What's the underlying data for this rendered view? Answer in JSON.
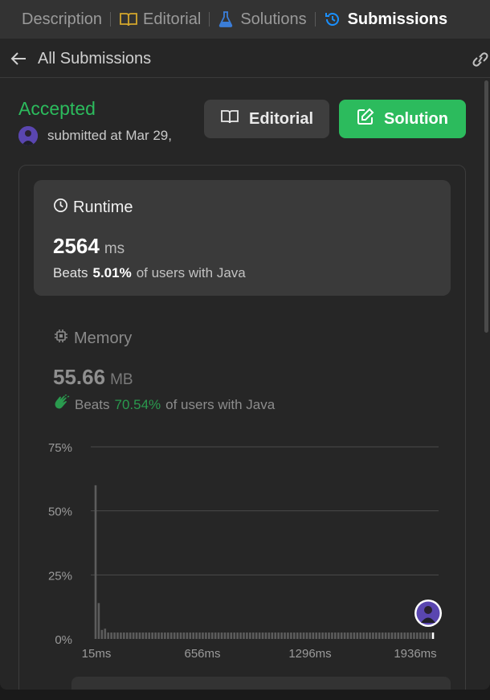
{
  "tabs": [
    {
      "label": "Description",
      "active": false
    },
    {
      "label": "Editorial",
      "active": false
    },
    {
      "label": "Solutions",
      "active": false
    },
    {
      "label": "Submissions",
      "active": true
    }
  ],
  "subheader": {
    "back_label": "All Submissions"
  },
  "submission": {
    "status": "Accepted",
    "submitted_text": "submitted at Mar 29,",
    "editorial_btn": "Editorial",
    "solution_btn": "Solution"
  },
  "runtime": {
    "title": "Runtime",
    "value": "2564",
    "unit": "ms",
    "beats_prefix": "Beats",
    "beats_pct": "5.01%",
    "beats_suffix": "of users with Java"
  },
  "memory": {
    "title": "Memory",
    "value": "55.66",
    "unit": "MB",
    "beats_prefix": "Beats",
    "beats_pct": "70.54%",
    "beats_suffix": "of users with Java"
  },
  "colors": {
    "accent_green": "#2cbb5d",
    "active_tab_icon": "#1a90ff"
  },
  "chart_data": {
    "type": "bar",
    "x_tick_labels": [
      "15ms",
      "656ms",
      "1296ms",
      "1936ms"
    ],
    "y_tick_labels": [
      "75%",
      "50%",
      "25%",
      "0%"
    ],
    "ylim": [
      0,
      75
    ],
    "values": [
      60,
      14,
      3.5,
      4,
      2.5,
      2.5,
      2.5,
      2.5,
      2.5,
      2.5,
      2.5,
      2.5,
      2.5,
      2.5,
      2.5,
      2.5,
      2.5,
      2.5,
      2.5,
      2.5,
      2.5,
      2.5,
      2.5,
      2.5,
      2.5,
      2.5,
      2.5,
      2.5,
      2.5,
      2.5,
      2.5,
      2.5,
      2.5,
      2.5,
      2.5,
      2.5,
      2.5,
      2.5,
      2.5,
      2.5,
      2.5,
      2.5,
      2.5,
      2.5,
      2.5,
      2.5,
      2.5,
      2.5,
      2.5,
      2.5,
      2.5,
      2.5,
      2.5,
      2.5,
      2.5,
      2.5,
      2.5,
      2.5,
      2.5,
      2.5,
      2.5,
      2.5,
      2.5,
      2.5,
      2.5,
      2.5,
      2.5,
      2.5,
      2.5,
      2.5,
      2.5,
      2.5,
      2.5,
      2.5,
      2.5,
      2.5,
      2.5,
      2.5,
      2.5,
      2.5,
      2.5,
      2.5,
      2.5,
      2.5,
      2.5,
      2.5,
      2.5,
      2.5,
      2.5,
      2.5,
      2.5,
      2.5,
      2.5,
      2.5,
      2.5,
      2.5,
      2.5,
      2.5,
      2.5,
      2.5,
      2.5,
      2.5,
      2.5,
      2.5,
      2.5,
      2.5,
      2.5,
      2.5
    ],
    "highlight_index": 107,
    "grid": true
  }
}
